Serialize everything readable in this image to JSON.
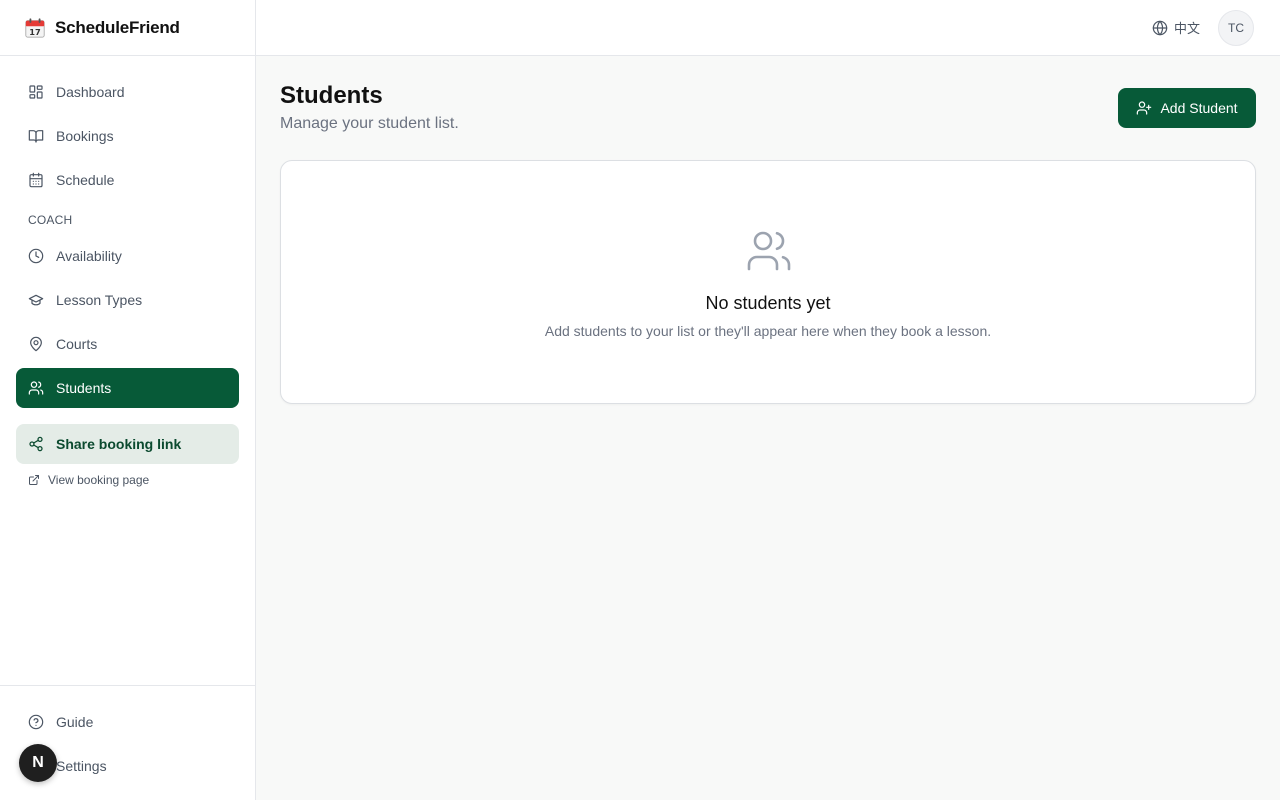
{
  "app": {
    "brand_name": "ScheduleFriend",
    "brand_icon": "calendar-icon"
  },
  "sidebar": {
    "items": [
      {
        "label": "Dashboard",
        "icon": "grid-icon"
      },
      {
        "label": "Bookings",
        "icon": "book-icon"
      },
      {
        "label": "Schedule",
        "icon": "calendar-icon"
      }
    ],
    "section_label": "COACH",
    "coach_items": [
      {
        "label": "Availability",
        "icon": "clock-icon"
      },
      {
        "label": "Lesson Types",
        "icon": "graduation-cap-icon"
      },
      {
        "label": "Courts",
        "icon": "map-pin-icon"
      },
      {
        "label": "Students",
        "icon": "users-icon",
        "active": true
      }
    ],
    "share_label": "Share booking link",
    "view_label": "View booking page",
    "bottom_items": [
      {
        "label": "Guide",
        "icon": "help-circle-icon"
      },
      {
        "label": "Settings",
        "icon": "gear-icon"
      }
    ],
    "dev_badge": "N"
  },
  "header": {
    "language_label": "中文",
    "avatar_initials": "TC"
  },
  "main": {
    "title": "Students",
    "subtitle": "Manage your student list.",
    "add_button_label": "Add Student",
    "empty_title": "No students yet",
    "empty_description": "Add students to your list or they'll appear here when they book a lesson."
  },
  "colors": {
    "accent": "#075a38",
    "accent_soft": "#e4ece7",
    "background": "#f8f9f8"
  }
}
